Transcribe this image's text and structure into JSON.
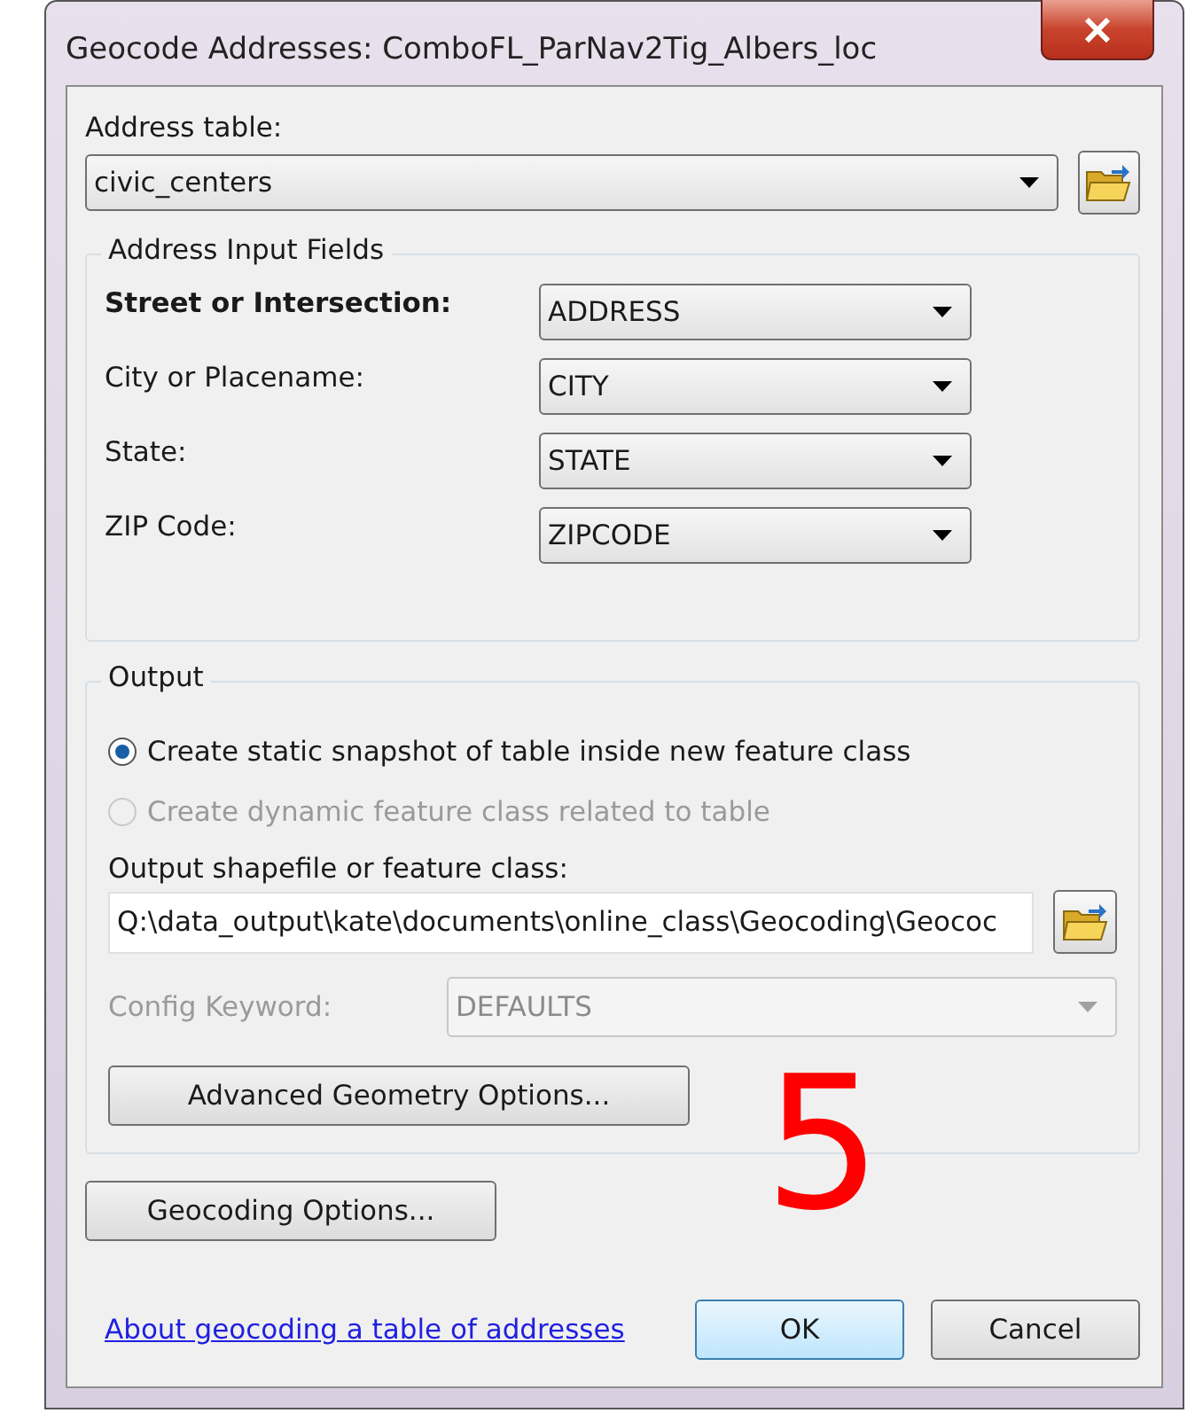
{
  "window": {
    "title": "Geocode Addresses:  ComboFL_ParNav2Tig_Albers_loc"
  },
  "address_table": {
    "label": "Address table:",
    "value": "civic_centers"
  },
  "address_input_fields": {
    "title": "Address Input Fields",
    "fields": [
      {
        "label": "Street or Intersection:",
        "value": "ADDRESS",
        "required": true
      },
      {
        "label": "City or Placename:",
        "value": "CITY",
        "required": false
      },
      {
        "label": "State:",
        "value": "STATE",
        "required": false
      },
      {
        "label": "ZIP Code:",
        "value": "ZIPCODE",
        "required": false
      }
    ]
  },
  "output": {
    "title": "Output",
    "options": [
      {
        "label": "Create static snapshot of table inside new feature class",
        "selected": true,
        "disabled": false
      },
      {
        "label": "Create dynamic feature class related to table",
        "selected": false,
        "disabled": true
      }
    ],
    "path_label": "Output shapefile or feature class:",
    "path": "Q:\\data_output\\kate\\documents\\online_class\\Geocoding\\Geococ",
    "config": {
      "label": "Config Keyword:",
      "value": "DEFAULTS",
      "disabled": true
    },
    "advanced_button": "Advanced Geometry Options..."
  },
  "geocoding_options_button": "Geocoding Options...",
  "help_link": "About geocoding a table of addresses",
  "buttons": [
    {
      "label": "OK",
      "default": true
    },
    {
      "label": "Cancel",
      "default": false
    }
  ],
  "annotation": "5"
}
